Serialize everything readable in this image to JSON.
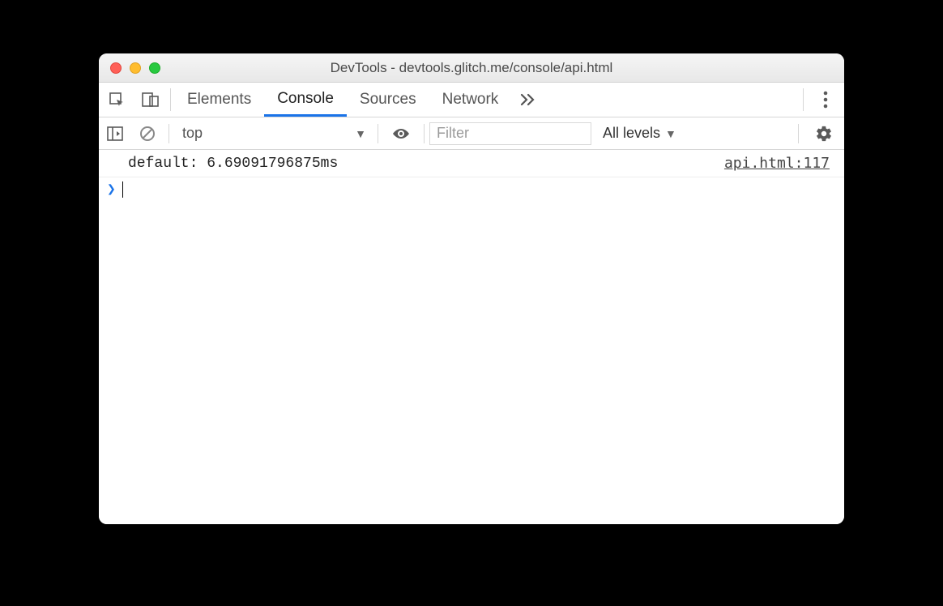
{
  "window": {
    "title": "DevTools - devtools.glitch.me/console/api.html"
  },
  "tabs": {
    "items": [
      "Elements",
      "Console",
      "Sources",
      "Network"
    ],
    "active": "Console"
  },
  "toolbar": {
    "context": "top",
    "filter_placeholder": "Filter",
    "levels_label": "All levels"
  },
  "console": {
    "entries": [
      {
        "message": "default: 6.69091796875ms",
        "source": "api.html:117"
      }
    ]
  },
  "icons": {
    "inspect": "inspect-icon",
    "device": "device-icon",
    "more_tabs": "chevron-right-double",
    "kebab": "kebab-icon",
    "sidebar": "sidebar-toggle-icon",
    "clear": "clear-icon",
    "eye": "eye-icon",
    "gear": "gear-icon",
    "prompt": "prompt-chevron"
  }
}
